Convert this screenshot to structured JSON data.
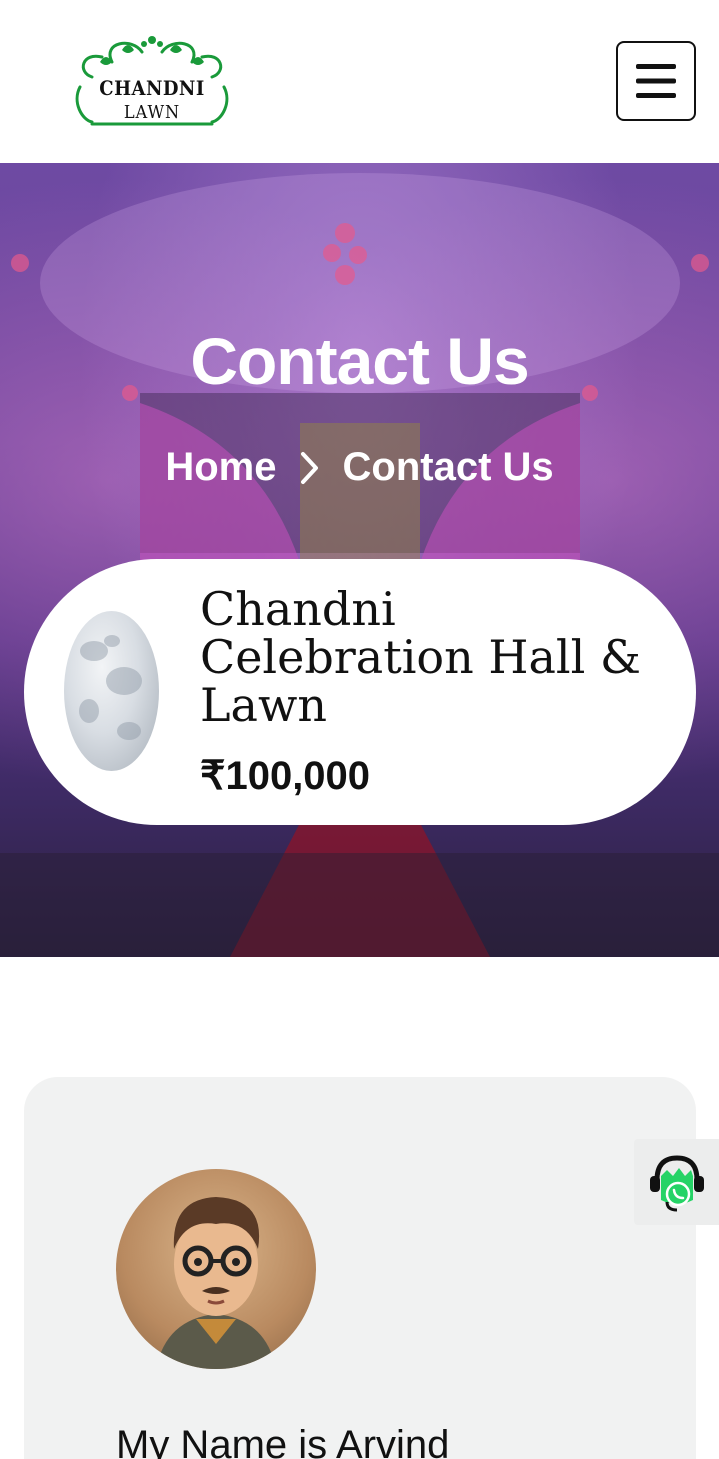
{
  "header": {
    "logo_line1": "CHANDNI",
    "logo_line2": "LAWN",
    "menu_icon": "hamburger-icon"
  },
  "hero": {
    "title": "Contact Us",
    "breadcrumb": {
      "home": "Home",
      "separator_icon": "chevron-right-icon",
      "current": "Contact Us"
    }
  },
  "venue": {
    "name": "Chandni Celebration Hall & Lawn",
    "price": "₹100,000"
  },
  "profile": {
    "name": "My Name is Arvind"
  },
  "widget": {
    "icon": "whatsapp-support-icon"
  },
  "colors": {
    "hero_overlay": "#6a4399",
    "card_bg": "#ffffff",
    "profile_bg": "#f1f2f2",
    "logo_green": "#1a9a3a",
    "whatsapp_green": "#25d366"
  }
}
